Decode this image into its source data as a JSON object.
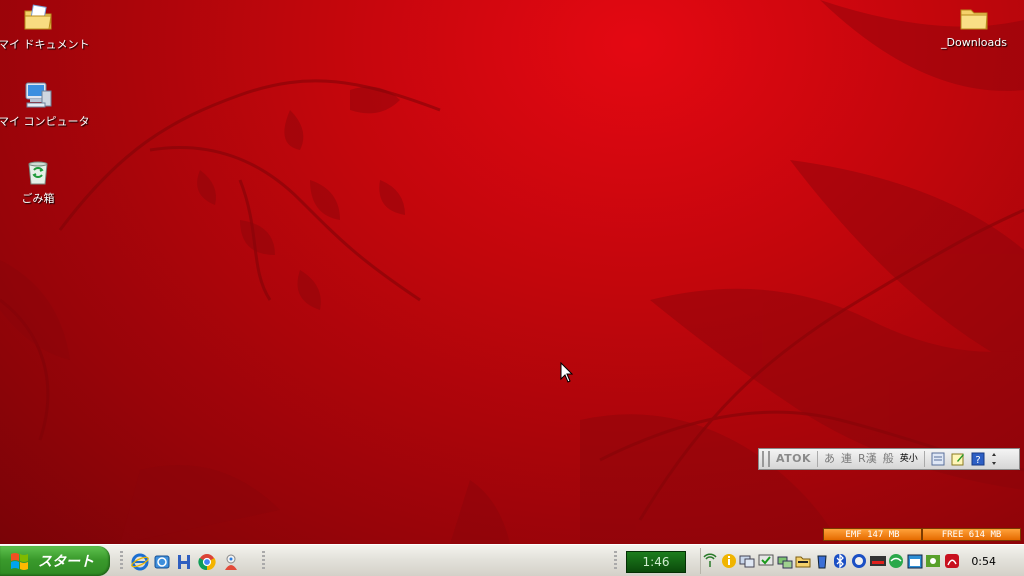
{
  "desktop": {
    "icons": [
      {
        "label": "マイ ドキュメント",
        "icon": "my-documents-folder-icon"
      },
      {
        "label": "マイ コンピュータ",
        "icon": "my-computer-icon"
      },
      {
        "label": "ごみ箱",
        "icon": "recycle-bin-icon"
      },
      {
        "label": "_Downloads",
        "icon": "folder-icon"
      }
    ],
    "background_color": "#c2060c"
  },
  "atok": {
    "logo": "ATOK",
    "mode_hiragana": "あ",
    "mode_ren": "連",
    "mode_r": "R",
    "mode_kan": "漢",
    "mode_han": "般",
    "mode_eisho": "英小"
  },
  "memory": {
    "used": "EMF 147 MB",
    "free": "FREE 614 MB"
  },
  "taskbar": {
    "start_label": "スタート",
    "quicklaunch": [
      "internet-explorer-icon",
      "outlook-express-icon",
      "h-app-icon",
      "chrome-icon",
      "msn-icon"
    ],
    "timer": "1:46",
    "clock": "0:54"
  },
  "colors": {
    "start_green": "#3a9a2c",
    "taskbar": "#e3e2db",
    "meter_orange": "#e56b00"
  }
}
